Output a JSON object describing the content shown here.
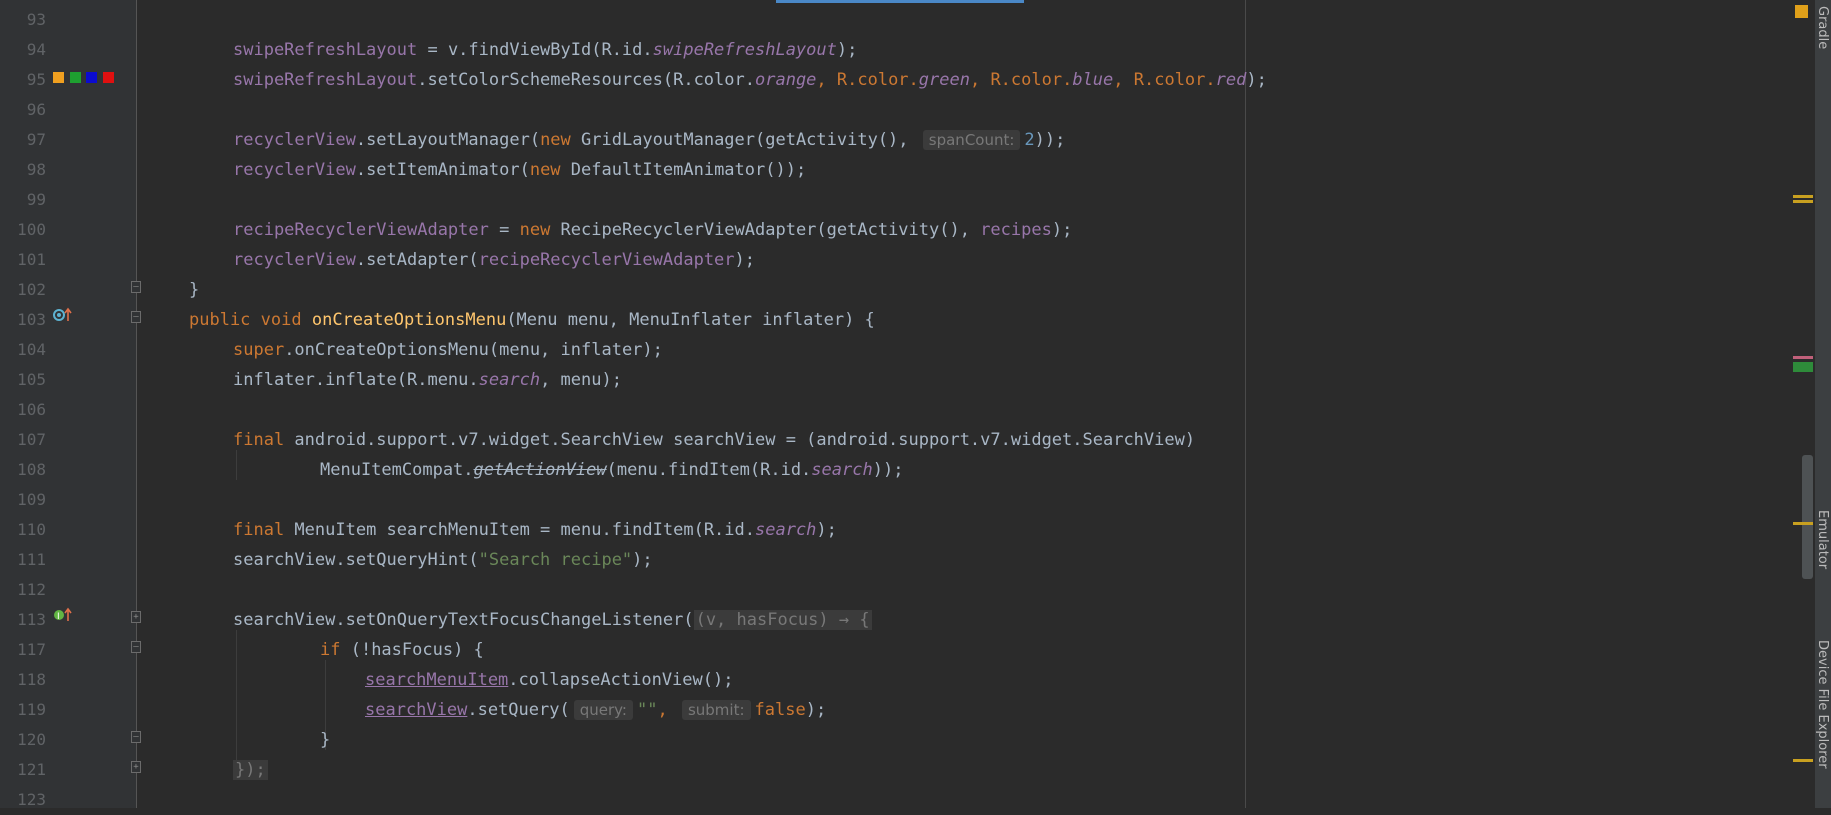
{
  "colors": {
    "swatch_orange": "#f0a020",
    "swatch_green": "#1ea030",
    "swatch_blue": "#0b0bd0",
    "swatch_red": "#e01010",
    "override_icon": "#5db2d0",
    "implement_icon": "#62b543"
  },
  "icons": {
    "override": "override-method-icon",
    "implement": "implement-method-icon",
    "fold": "fold-marker-icon"
  },
  "side_tools": {
    "top": "Gradle",
    "mid": "Emulator",
    "bottom": "Device File Explorer"
  },
  "editor": {
    "lines": [
      {
        "n": "93"
      },
      {
        "n": "94"
      },
      {
        "n": "95"
      },
      {
        "n": "96"
      },
      {
        "n": "97"
      },
      {
        "n": "98"
      },
      {
        "n": "99"
      },
      {
        "n": "100"
      },
      {
        "n": "101"
      },
      {
        "n": "102"
      },
      {
        "n": "103"
      },
      {
        "n": "104"
      },
      {
        "n": "105"
      },
      {
        "n": "106"
      },
      {
        "n": "107"
      },
      {
        "n": "108"
      },
      {
        "n": "109"
      },
      {
        "n": "110"
      },
      {
        "n": "111"
      },
      {
        "n": "112"
      },
      {
        "n": "113"
      },
      {
        "n": "117"
      },
      {
        "n": "118"
      },
      {
        "n": "119"
      },
      {
        "n": "120"
      },
      {
        "n": "121"
      },
      {
        "n": "123"
      }
    ],
    "code": {
      "l94": {
        "a": "swipeRefreshLayout",
        "b": " = v.findViewById(R.id.",
        "c": "swipeRefreshLayout",
        "d": ");"
      },
      "l95": {
        "a": "swipeRefreshLayout",
        "b": ".setColorSchemeResources(R.color.",
        "c": "orange",
        "d": ", R.color.",
        "e": "green",
        "f": ", R.color.",
        "g": "blue",
        "h": ", R.color.",
        "i": "red",
        "j": ");"
      },
      "l97": {
        "a": "recyclerView",
        "b": ".setLayoutManager(",
        "c": "new",
        "d": " GridLayoutManager(getActivity(), ",
        "hint": "spanCount:",
        "num": "2",
        "e": "));"
      },
      "l98": {
        "a": "recyclerView",
        "b": ".setItemAnimator(",
        "c": "new",
        "d": " DefaultItemAnimator());"
      },
      "l100": {
        "a": "recipeRecyclerViewAdapter",
        "b": " = ",
        "c": "new",
        "d": " RecipeRecyclerViewAdapter(getActivity(), ",
        "e": "recipes",
        "f": ");"
      },
      "l101": {
        "a": "recyclerView",
        "b": ".setAdapter(",
        "c": "recipeRecyclerViewAdapter",
        "d": ");"
      },
      "l102": {
        "a": "}"
      },
      "l103": {
        "kw": "public void",
        "m": "onCreateOptionsMenu",
        "r": "(Menu menu, MenuInflater inflater) {"
      },
      "l104": {
        "kw": "super",
        "r": ".onCreateOptionsMenu(menu, inflater);"
      },
      "l105": {
        "a": "inflater.inflate(R.menu.",
        "b": "search",
        "c": ", menu);"
      },
      "l107": {
        "kw": "final",
        "r": " android.support.v7.widget.SearchView searchView = (android.support.v7.widget.SearchView)"
      },
      "l108": {
        "a": "MenuItemCompat.",
        "b": "getActionView",
        "c": "(menu.findItem(R.id.",
        "d": "search",
        "e": "));"
      },
      "l110": {
        "kw": "final",
        "a": " MenuItem searchMenuItem = menu.findItem(R.id.",
        "b": "search",
        "c": ");"
      },
      "l111": {
        "a": "searchView.setQueryHint(",
        "s": "\"Search recipe\"",
        "b": ");"
      },
      "l113": {
        "a": "searchView.setOnQueryTextFocusChangeListener(",
        "lam": "(v, hasFocus) → {"
      },
      "l117": {
        "kw": "if",
        "r": " (!hasFocus) {"
      },
      "l118": {
        "a": "searchMenuItem",
        "b": ".collapseActionView();"
      },
      "l119": {
        "a": "searchView",
        "b": ".setQuery(",
        "h1": "query:",
        "s": "\"\"",
        "c": ", ",
        "h2": "submit:",
        "kw": "false",
        "d": ");"
      },
      "l120": {
        "a": "}"
      },
      "l121": {
        "a": "});"
      }
    }
  },
  "scroll_marks": [
    {
      "color": "#c8a020"
    },
    {
      "color": "#c8a020"
    },
    {
      "color": "#c0607a"
    },
    {
      "color": "#2e8b3a"
    },
    {
      "color": "#c8a020"
    },
    {
      "color": "#c8a020"
    }
  ]
}
